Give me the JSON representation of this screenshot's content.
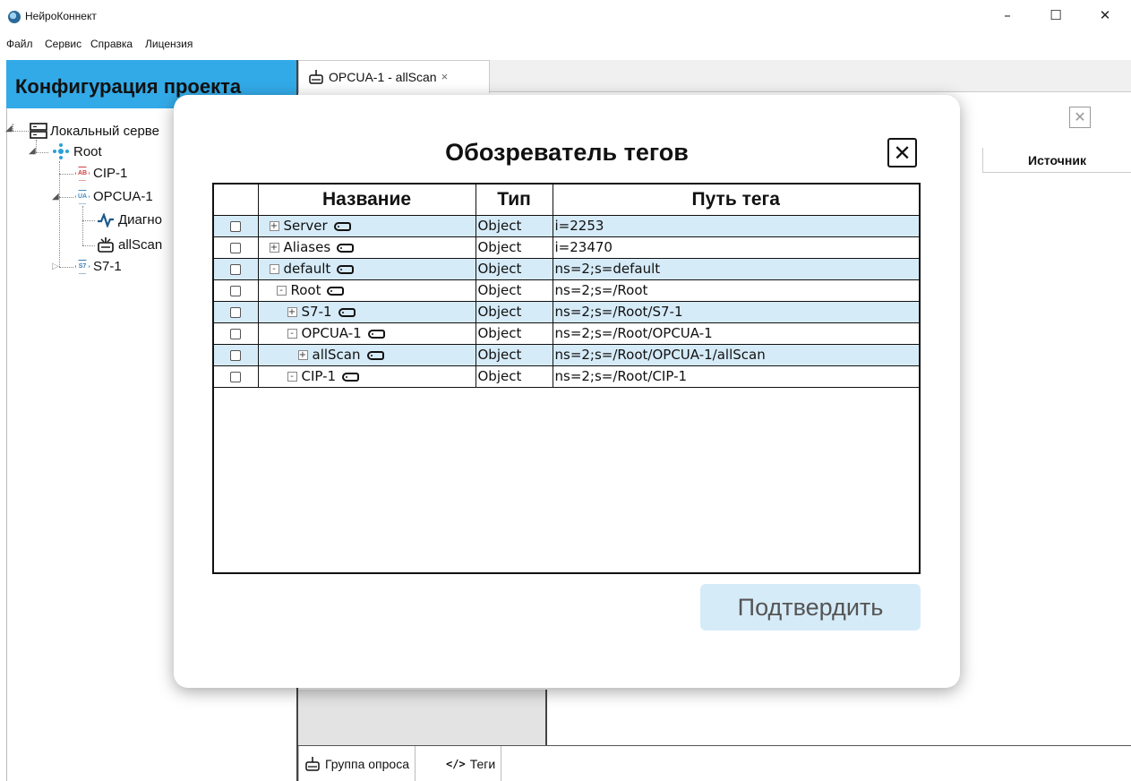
{
  "window": {
    "title": "НейроКоннект",
    "minimize_glyph": "–",
    "maximize_glyph": "☐",
    "close_glyph": "✕"
  },
  "menu": [
    "Файл",
    "Сервис",
    "Справка",
    "Лицензия"
  ],
  "project_panel": {
    "title": "Конфигурация проекта",
    "tree": [
      {
        "label": "Локальный серве",
        "icon": "server-icon"
      },
      {
        "label": "Root",
        "icon": "network-icon"
      },
      {
        "label": "CIP-1",
        "icon": "ab-badge-icon",
        "badge": "AB"
      },
      {
        "label": "OPCUA-1",
        "icon": "ua-badge-icon",
        "badge": "UA"
      },
      {
        "label": "Диагно",
        "icon": "diagnostics-icon"
      },
      {
        "label": "allScan",
        "icon": "poll-group-icon"
      },
      {
        "label": "S7-1",
        "icon": "s7-badge-icon",
        "badge": "S7"
      }
    ]
  },
  "doc_tab": {
    "label": "OPCUA-1 - allScan",
    "close_glyph": "×"
  },
  "grid": {
    "source_header": "Источник",
    "close_glyph": "✕"
  },
  "bottom_tabs": [
    {
      "label": "Группа опроса",
      "icon": "poll-group-icon"
    },
    {
      "label": "Теги",
      "icon": "code-icon"
    }
  ],
  "modal": {
    "title": "Обозреватель тегов",
    "close_glyph": "✕",
    "columns": {
      "name": "Название",
      "type": "Тип",
      "path": "Путь тега"
    },
    "rows": [
      {
        "name": "Server",
        "expander": "+",
        "type": "Object",
        "path": "i=2253"
      },
      {
        "name": "Aliases",
        "expander": "+",
        "type": "Object",
        "path": "i=23470"
      },
      {
        "name": "default",
        "expander": "-",
        "type": "Object",
        "path": "ns=2;s=default"
      },
      {
        "name": "Root",
        "expander": "-",
        "type": "Object",
        "path": "ns=2;s=/Root"
      },
      {
        "name": "S7-1",
        "expander": "+",
        "type": "Object",
        "path": "ns=2;s=/Root/S7-1"
      },
      {
        "name": "OPCUA-1",
        "expander": "-",
        "type": "Object",
        "path": "ns=2;s=/Root/OPCUA-1"
      },
      {
        "name": "allScan",
        "expander": "+",
        "type": "Object",
        "path": "ns=2;s=/Root/OPCUA-1/allScan"
      },
      {
        "name": "CIP-1",
        "expander": "-",
        "type": "Object",
        "path": "ns=2;s=/Root/CIP-1"
      }
    ],
    "confirm_label": "Подтвердить"
  },
  "colors": {
    "accent": "#32aae8",
    "row_alt": "#d6ebf8",
    "confirm_bg": "#d6ebf8"
  }
}
